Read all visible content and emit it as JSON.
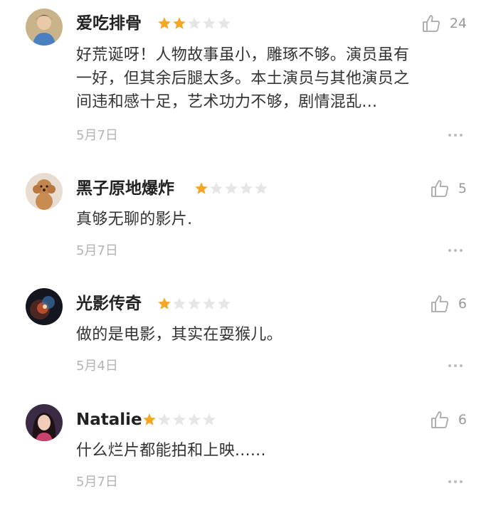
{
  "colors": {
    "star_filled": "#f5a623",
    "star_empty": "#e6e6e6",
    "muted": "#9a9a9a"
  },
  "reviews": [
    {
      "username": "爱吃排骨",
      "rating": 2,
      "likes": "24",
      "lines": [
        "好荒诞呀！人物故事虽小，雕琢不够。演员虽有",
        "一好，但其余后腿太多。本土演员与其他演员之",
        "间违和感十足，艺术功力不够，剧情混乱..."
      ],
      "date": "5月7日",
      "avatar_icon": "person-avatar",
      "like_icon": "thumbs-up-icon"
    },
    {
      "username": "黑子原地爆炸",
      "rating": 1,
      "likes": "5",
      "lines": [
        "真够无聊的影片."
      ],
      "date": "5月7日",
      "avatar_icon": "poodle-avatar",
      "like_icon": "thumbs-up-icon"
    },
    {
      "username": "光影传奇",
      "rating": 1,
      "likes": "6",
      "lines": [
        "做的是电影，其实在耍猴儿。"
      ],
      "date": "5月4日",
      "avatar_icon": "nebula-avatar",
      "like_icon": "thumbs-up-icon"
    },
    {
      "username": "Natalie",
      "rating": 1,
      "likes": "6",
      "lines": [
        "什么烂片都能拍和上映......"
      ],
      "date": "5月7日",
      "avatar_icon": "woman-avatar",
      "like_icon": "thumbs-up-icon"
    }
  ]
}
